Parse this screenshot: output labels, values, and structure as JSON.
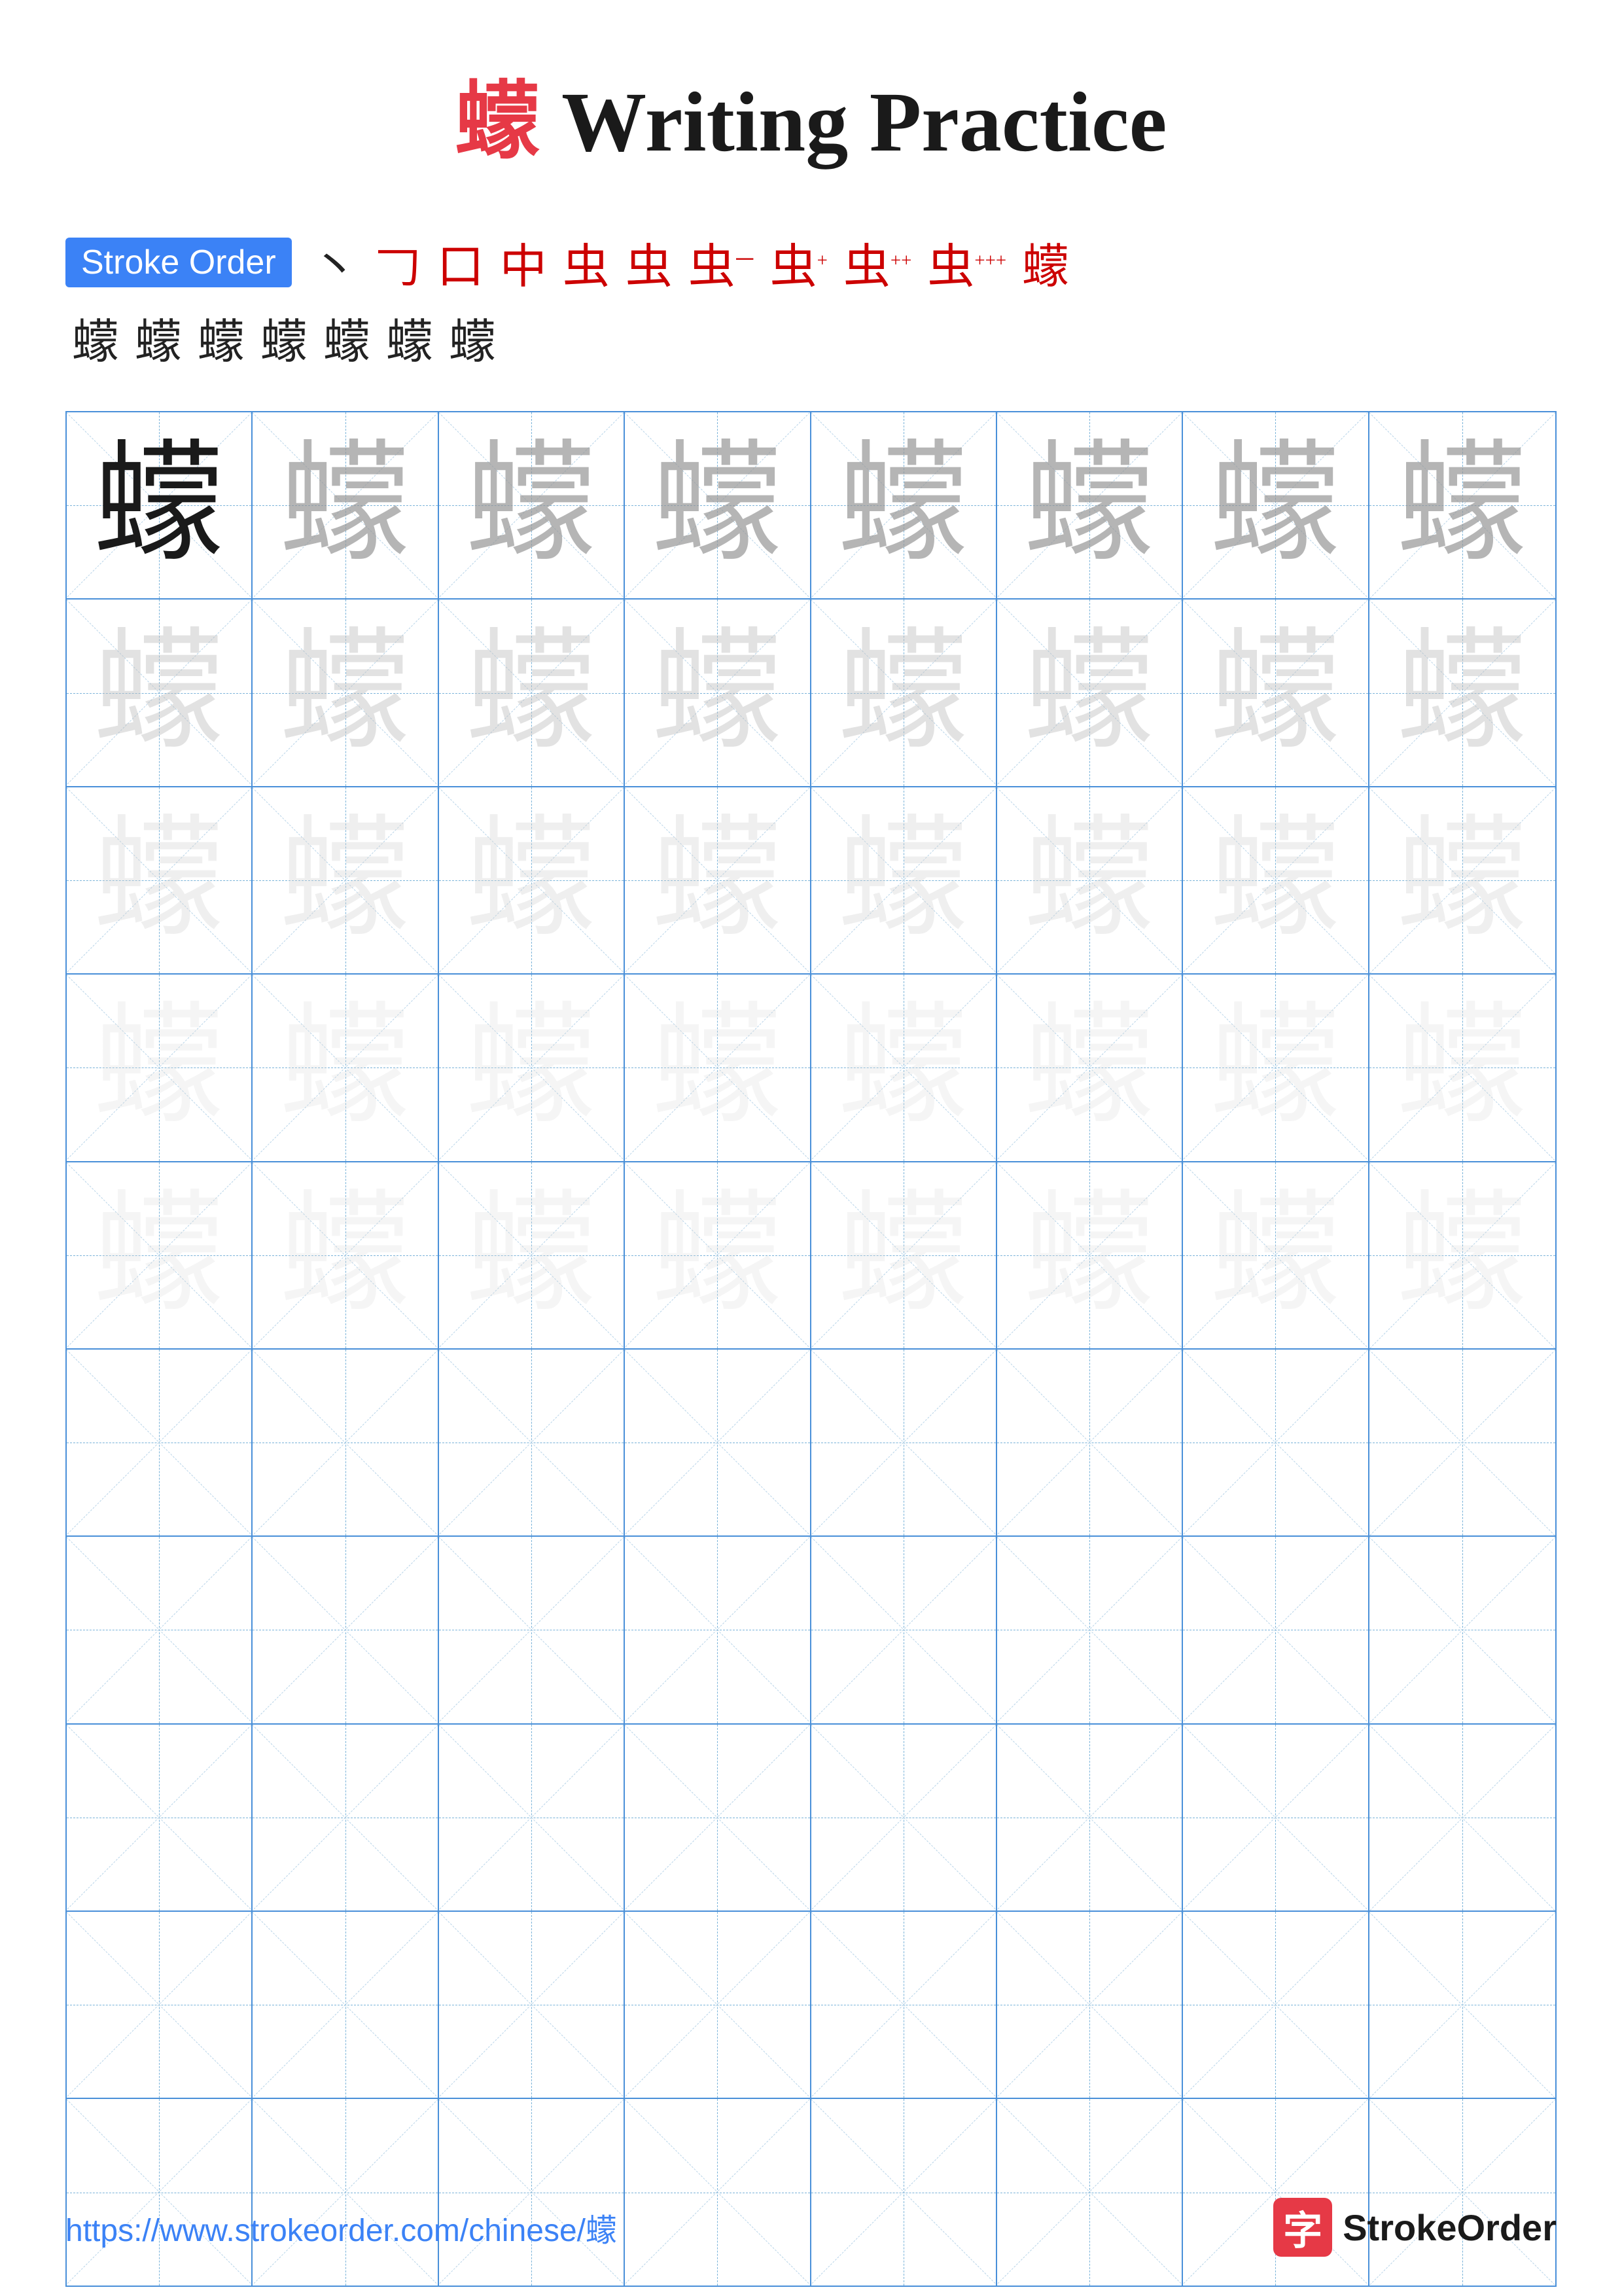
{
  "page": {
    "title": {
      "char": "蠓",
      "rest": " Writing Practice"
    },
    "stroke_order": {
      "badge_label": "Stroke Order",
      "row1_chars": [
        "丶",
        "𠃌",
        "口",
        "中",
        "虫",
        "虫",
        "虫⁻",
        "虫⁺",
        "虫⁺⁺",
        "虫⁺⁺⁺",
        "蠓"
      ],
      "row2_chars": [
        "蠓",
        "蠓",
        "蠓",
        "蠓",
        "蠓",
        "蠓",
        "蠓"
      ]
    },
    "practice": {
      "character": "蠓",
      "rows": 10,
      "cols": 8,
      "char_intensity": [
        [
          "dark",
          "medium",
          "medium",
          "medium",
          "medium",
          "medium",
          "medium",
          "medium"
        ],
        [
          "light",
          "light",
          "light",
          "light",
          "light",
          "light",
          "light",
          "light"
        ],
        [
          "very-light",
          "very-light",
          "very-light",
          "very-light",
          "very-light",
          "very-light",
          "very-light",
          "very-light"
        ],
        [
          "ultra-light",
          "ultra-light",
          "ultra-light",
          "ultra-light",
          "ultra-light",
          "ultra-light",
          "ultra-light",
          "ultra-light"
        ],
        [
          "ultra-light",
          "ultra-light",
          "ultra-light",
          "ultra-light",
          "ultra-light",
          "ultra-light",
          "ultra-light",
          "ultra-light"
        ],
        [
          "empty",
          "empty",
          "empty",
          "empty",
          "empty",
          "empty",
          "empty",
          "empty"
        ],
        [
          "empty",
          "empty",
          "empty",
          "empty",
          "empty",
          "empty",
          "empty",
          "empty"
        ],
        [
          "empty",
          "empty",
          "empty",
          "empty",
          "empty",
          "empty",
          "empty",
          "empty"
        ],
        [
          "empty",
          "empty",
          "empty",
          "empty",
          "empty",
          "empty",
          "empty",
          "empty"
        ],
        [
          "empty",
          "empty",
          "empty",
          "empty",
          "empty",
          "empty",
          "empty",
          "empty"
        ]
      ]
    },
    "footer": {
      "url": "https://www.strokeorder.com/chinese/蠓",
      "logo_char": "字",
      "logo_text": "StrokeOrder"
    }
  }
}
